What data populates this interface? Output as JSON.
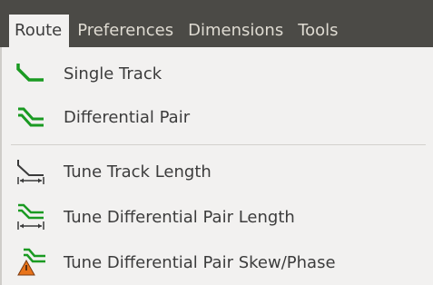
{
  "menubar": {
    "menus": [
      {
        "label": "Route"
      },
      {
        "label": "Preferences"
      },
      {
        "label": "Dimensions"
      },
      {
        "label": "Tools"
      }
    ]
  },
  "route_menu": {
    "items": [
      {
        "label": "Single Track",
        "icon": "single-track-icon"
      },
      {
        "label": "Differential Pair",
        "icon": "differential-pair-icon"
      },
      {
        "label": "Tune Track Length",
        "icon": "tune-track-length-icon"
      },
      {
        "label": "Tune Differential Pair Length",
        "icon": "tune-diff-pair-length-icon"
      },
      {
        "label": "Tune Differential Pair Skew/Phase",
        "icon": "tune-diff-pair-skew-icon"
      }
    ]
  },
  "colors": {
    "menubar_bg": "#4b4a46",
    "menu_bg": "#f2f1f0",
    "track_green": "#1a9a22",
    "warning_orange": "#e8731a"
  }
}
